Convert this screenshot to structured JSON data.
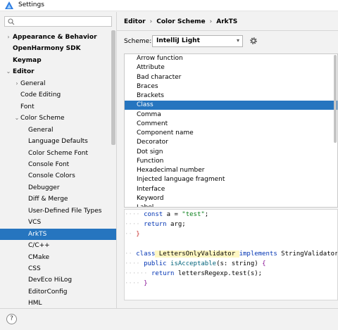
{
  "window": {
    "title": "Settings"
  },
  "search": {
    "placeholder": ""
  },
  "tree": [
    {
      "label": "Appearance & Behavior",
      "arrow": "›",
      "bold": true,
      "level": 0
    },
    {
      "label": "OpenHarmony SDK",
      "arrow": "",
      "bold": true,
      "level": 0
    },
    {
      "label": "Keymap",
      "arrow": "",
      "bold": true,
      "level": 0
    },
    {
      "label": "Editor",
      "arrow": "⌄",
      "bold": true,
      "level": 0
    },
    {
      "label": "General",
      "arrow": "›",
      "bold": false,
      "level": 1
    },
    {
      "label": "Code Editing",
      "arrow": "",
      "bold": false,
      "level": 1
    },
    {
      "label": "Font",
      "arrow": "",
      "bold": false,
      "level": 1
    },
    {
      "label": "Color Scheme",
      "arrow": "⌄",
      "bold": false,
      "level": 1
    },
    {
      "label": "General",
      "arrow": "",
      "bold": false,
      "level": 2
    },
    {
      "label": "Language Defaults",
      "arrow": "",
      "bold": false,
      "level": 2
    },
    {
      "label": "Color Scheme Font",
      "arrow": "",
      "bold": false,
      "level": 2
    },
    {
      "label": "Console Font",
      "arrow": "",
      "bold": false,
      "level": 2
    },
    {
      "label": "Console Colors",
      "arrow": "",
      "bold": false,
      "level": 2
    },
    {
      "label": "Debugger",
      "arrow": "",
      "bold": false,
      "level": 2
    },
    {
      "label": "Diff & Merge",
      "arrow": "",
      "bold": false,
      "level": 2
    },
    {
      "label": "User-Defined File Types",
      "arrow": "",
      "bold": false,
      "level": 2
    },
    {
      "label": "VCS",
      "arrow": "",
      "bold": false,
      "level": 2
    },
    {
      "label": "ArkTS",
      "arrow": "",
      "bold": false,
      "level": 2,
      "selected": true
    },
    {
      "label": "C/C++",
      "arrow": "",
      "bold": false,
      "level": 2
    },
    {
      "label": "CMake",
      "arrow": "",
      "bold": false,
      "level": 2
    },
    {
      "label": "CSS",
      "arrow": "",
      "bold": false,
      "level": 2
    },
    {
      "label": "DevEco HiLog",
      "arrow": "",
      "bold": false,
      "level": 2
    },
    {
      "label": "EditorConfig",
      "arrow": "",
      "bold": false,
      "level": 2
    },
    {
      "label": "HML",
      "arrow": "",
      "bold": false,
      "level": 2
    }
  ],
  "breadcrumb": [
    "Editor",
    "Color Scheme",
    "ArkTS"
  ],
  "breadcrumb_sep": "›",
  "scheme": {
    "label": "Scheme:",
    "value": "IntelliJ Light",
    "caret": "▾"
  },
  "elements": [
    "Arrow function",
    "Attribute",
    "Bad character",
    "Braces",
    "Brackets",
    "Class",
    "Comma",
    "Comment",
    "Component name",
    "Decorator",
    "Dot sign",
    "Function",
    "Hexadecimal number",
    "Injected language fragment",
    "Interface",
    "Keyword",
    "Label"
  ],
  "selected_element": "Class",
  "code_preview": {
    "line1": {
      "kw": "const",
      "rest_a": " a = ",
      "str": "\"test\"",
      "end": ";"
    },
    "line2": {
      "kw": "return",
      "rest": " arg;"
    },
    "line3": {
      "brace": "}"
    },
    "line4": {
      "kw1": "class",
      "cls": " LettersOnlyValidator ",
      "kw2": "implements",
      "iface": " StringValidator"
    },
    "line5": {
      "kw": "public",
      "fn": " isAcceptable",
      "params": "(s: string) ",
      "brace": "{"
    },
    "line6": {
      "kw": "return",
      "rest": " lettersRegexp.test(s);"
    },
    "line7": {
      "brace": "}"
    }
  },
  "help": {
    "label": "?"
  },
  "colors": {
    "accent": "#2675bf",
    "keyword": "#0033b3",
    "string": "#067d17",
    "function": "#00627a"
  }
}
